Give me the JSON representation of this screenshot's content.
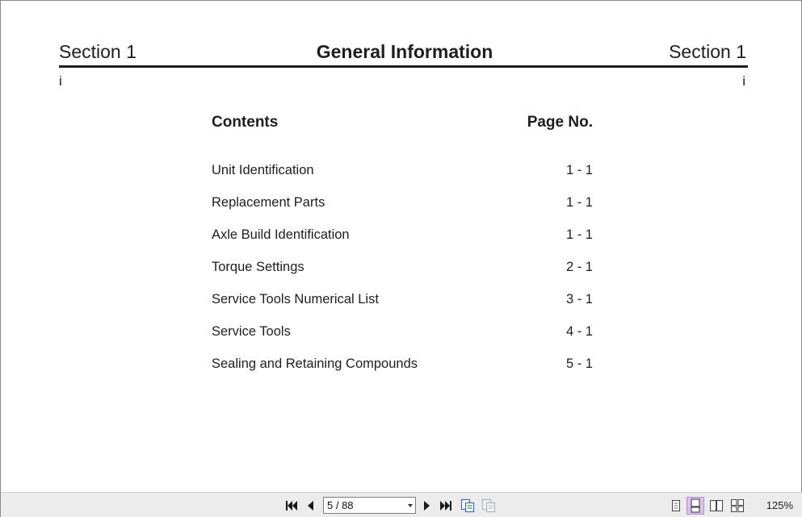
{
  "header": {
    "left": "Section 1",
    "center": "General Information",
    "right": "Section 1",
    "page_left": "i",
    "page_right": "i"
  },
  "toc": {
    "col_contents": "Contents",
    "col_page": "Page No.",
    "items": [
      {
        "title": "Unit Identification",
        "page": "1 - 1"
      },
      {
        "title": "Replacement Parts",
        "page": "1 - 1"
      },
      {
        "title": "Axle Build Identification",
        "page": "1 - 1"
      },
      {
        "title": "Torque Settings",
        "page": "2 - 1"
      },
      {
        "title": "Service Tools Numerical List",
        "page": "3 - 1"
      },
      {
        "title": "Service Tools",
        "page": "4 - 1"
      },
      {
        "title": "Sealing and Retaining Compounds",
        "page": "5 - 1"
      }
    ]
  },
  "toolbar": {
    "page_indicator": "5 / 88",
    "zoom": "125%",
    "icons": [
      "first-page-icon",
      "prev-page-icon",
      "next-page-icon",
      "last-page-icon",
      "copy-page-icon",
      "copy-disabled-icon",
      "single-page-view-icon",
      "continuous-view-icon",
      "two-page-view-icon",
      "two-page-continuous-icon"
    ]
  }
}
